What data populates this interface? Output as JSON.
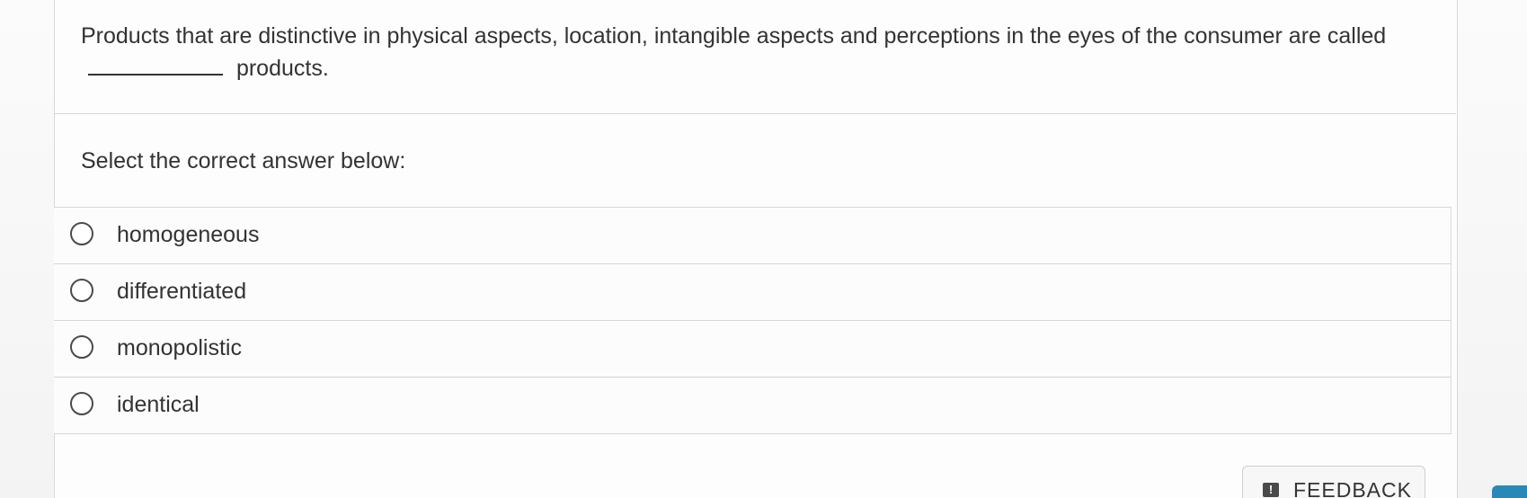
{
  "question": {
    "text_before": "Products that are distinctive in physical aspects, location, intangible aspects and perceptions in the eyes of the consumer are called",
    "text_after": "products."
  },
  "instruction": "Select the correct answer below:",
  "options": [
    {
      "label": "homogeneous"
    },
    {
      "label": "differentiated"
    },
    {
      "label": "monopolistic"
    },
    {
      "label": "identical"
    }
  ],
  "feedback": {
    "label": "FEEDBACK",
    "icon": "exclamation-icon"
  },
  "colors": {
    "text": "#333333",
    "accent_tab": "#2a88b8"
  }
}
